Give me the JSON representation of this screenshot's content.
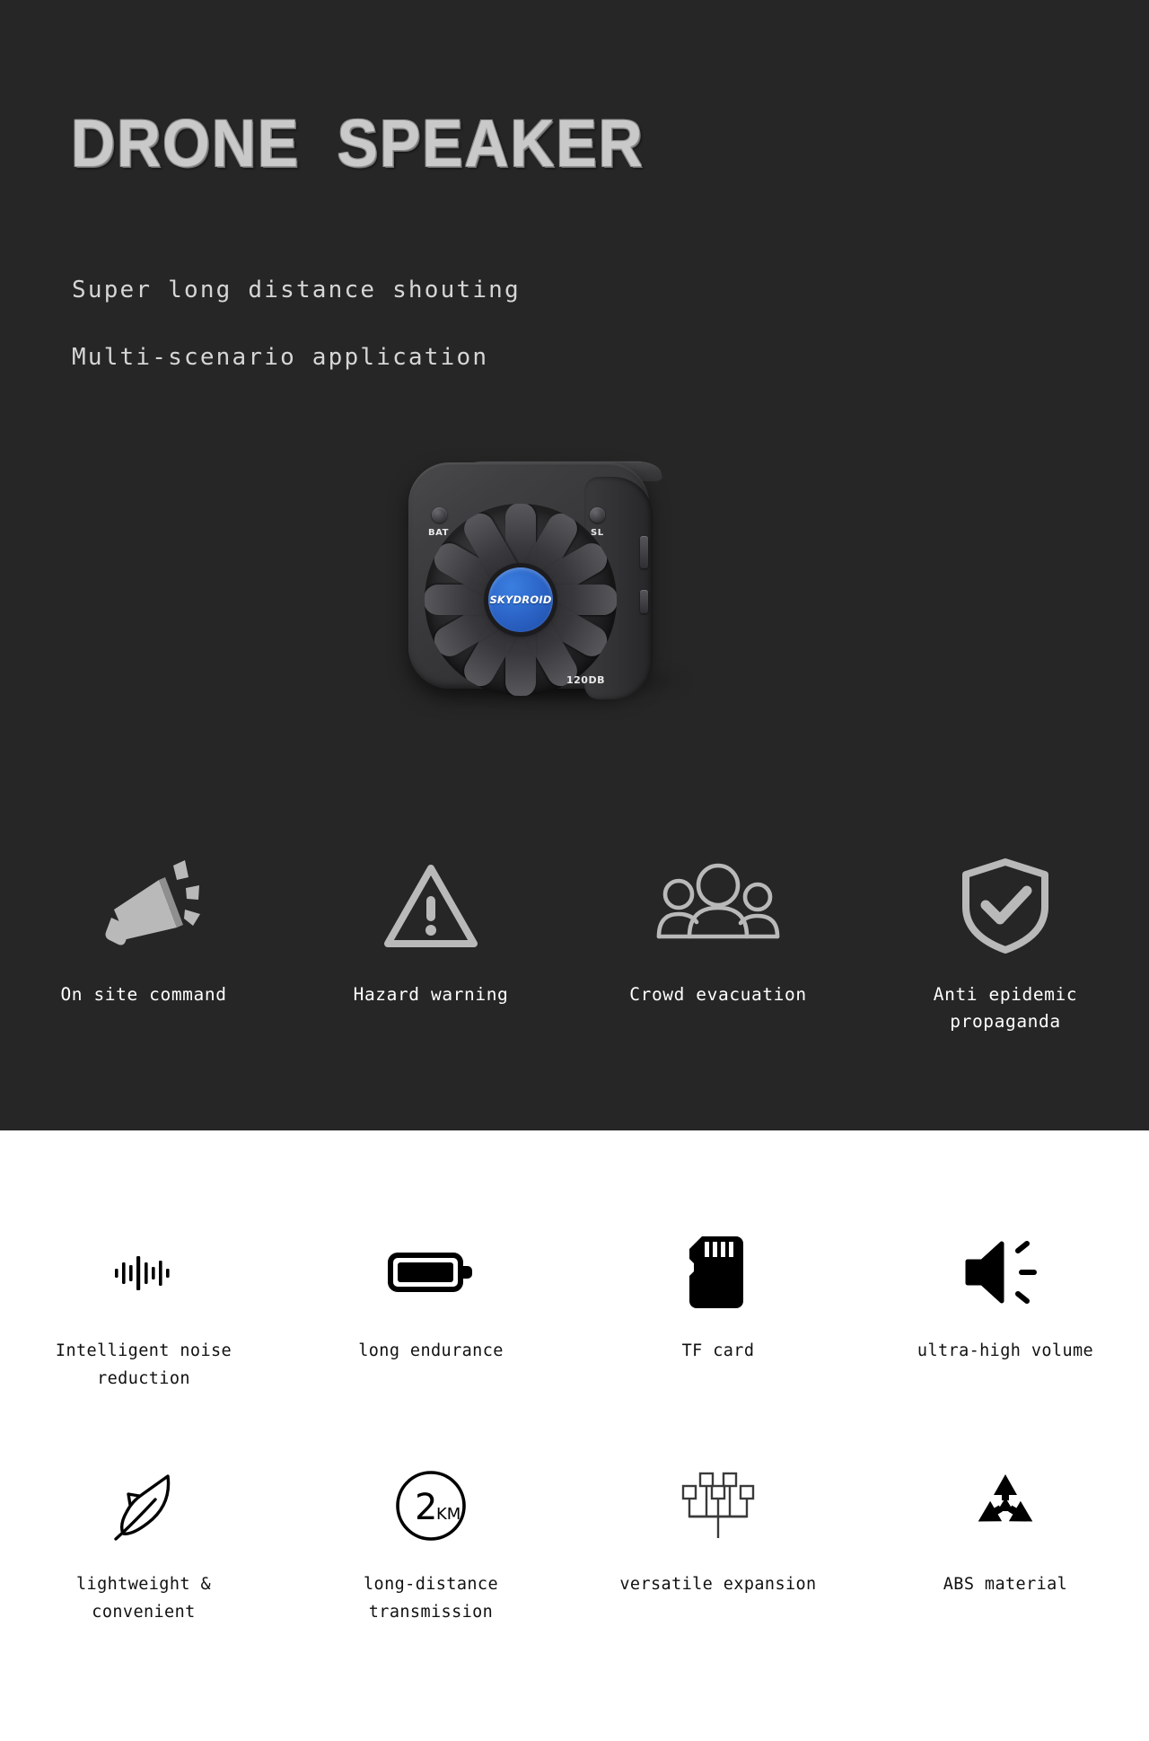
{
  "hero": {
    "title": "DRONE  SPEAKER",
    "subtitle_line1": "Super long distance shouting",
    "subtitle_line2": "Multi-scenario application",
    "background_color": "#262626",
    "text_color": "#ffffff"
  },
  "product": {
    "brand": "SKYDROID",
    "label_bat": "BAT",
    "label_sl": "SL",
    "label_db": "120DB",
    "hub_color": "#2a62c4",
    "body_color": "#3b3b3d"
  },
  "hero_features": [
    {
      "icon": "megaphone-icon",
      "label": "On site command"
    },
    {
      "icon": "warning-triangle-icon",
      "label": "Hazard warning"
    },
    {
      "icon": "crowd-people-icon",
      "label": "Crowd evacuation"
    },
    {
      "icon": "shield-check-icon",
      "label": "Anti epidemic\npropaganda"
    }
  ],
  "specs": {
    "row1": [
      {
        "icon": "sound-wave-icon",
        "label": "Intelligent noise\nreduction"
      },
      {
        "icon": "battery-icon",
        "label": "long endurance"
      },
      {
        "icon": "tf-card-icon",
        "label": "TF card"
      },
      {
        "icon": "speaker-volume-icon",
        "label": "ultra-high volume"
      }
    ],
    "row2": [
      {
        "icon": "feather-icon",
        "label": "lightweight &\nconvenient"
      },
      {
        "icon": "distance-2km-icon",
        "label": "long-distance\ntransmission",
        "value": "2",
        "unit": "KM"
      },
      {
        "icon": "expansion-tree-icon",
        "label": "versatile expansion"
      },
      {
        "icon": "recycle-icon",
        "label": "ABS material"
      }
    ]
  }
}
